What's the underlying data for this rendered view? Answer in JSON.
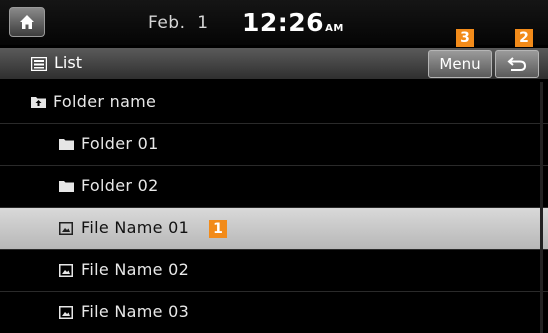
{
  "status_bar": {
    "date": "Feb.  1",
    "time": "12:26",
    "ampm": "AM"
  },
  "header": {
    "title": "List",
    "menu_label": "Menu"
  },
  "callouts": {
    "selected_item": "1",
    "back": "2",
    "menu": "3"
  },
  "list": {
    "parent_folder": "Folder name",
    "items": [
      {
        "type": "folder",
        "label": "Folder 01"
      },
      {
        "type": "folder",
        "label": "Folder 02"
      },
      {
        "type": "file",
        "label": "File Name 01",
        "selected": true
      },
      {
        "type": "file",
        "label": "File Name 02"
      },
      {
        "type": "file",
        "label": "File Name 03"
      }
    ]
  },
  "icons": {
    "home": "home-icon",
    "list": "list-icon",
    "back": "back-arrow-icon",
    "folder": "folder-icon",
    "folder_up": "folder-up-icon",
    "file": "image-file-icon"
  },
  "colors": {
    "background": "#000000",
    "callout": "#f28b1a",
    "selected_row": "#c8c8c8",
    "text": "#e8e8e8"
  }
}
